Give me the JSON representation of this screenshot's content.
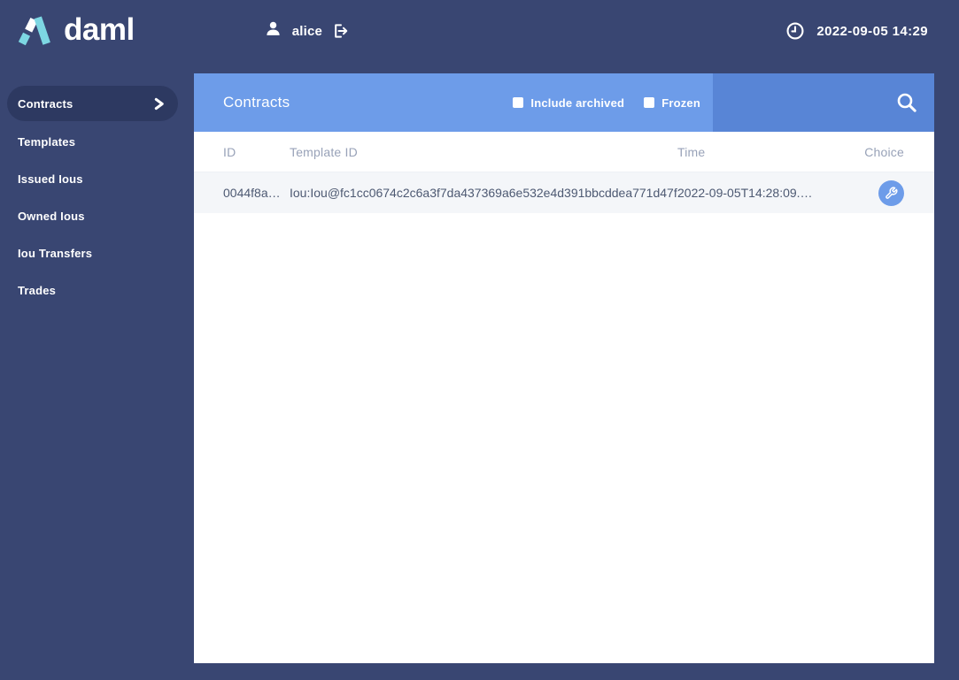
{
  "app": {
    "logo_text": "daml"
  },
  "topbar": {
    "username": "alice",
    "datetime": "2022-09-05 14:29"
  },
  "sidebar": {
    "items": [
      {
        "label": "Contracts",
        "active": true
      },
      {
        "label": "Templates",
        "active": false
      },
      {
        "label": "Issued Ious",
        "active": false
      },
      {
        "label": "Owned Ious",
        "active": false
      },
      {
        "label": "Iou Transfers",
        "active": false
      },
      {
        "label": "Trades",
        "active": false
      }
    ]
  },
  "main": {
    "title": "Contracts",
    "filters": [
      {
        "label": "Include archived",
        "checked": false
      },
      {
        "label": "Frozen",
        "checked": false
      }
    ],
    "table": {
      "columns": [
        "ID",
        "Template ID",
        "Time",
        "Choice"
      ],
      "rows": [
        {
          "id": "0044f8a…",
          "template_id": "Iou:Iou@fc1cc0674c2c6a3f7da437369a6e532e4d391bbcddea771d47f…",
          "time": "2022-09-05T14:28:09.…",
          "choice_icon": "wrench-icon"
        }
      ]
    }
  },
  "colors": {
    "background": "#394672",
    "active_item_bg": "#2d3961",
    "header_blue": "#6d9ce9",
    "search_blue": "#5885d6",
    "logo_teal": "#7dd7e3",
    "row_bg": "#f4f6f9",
    "muted_text": "#98a2b8",
    "row_text": "#4d5972"
  }
}
